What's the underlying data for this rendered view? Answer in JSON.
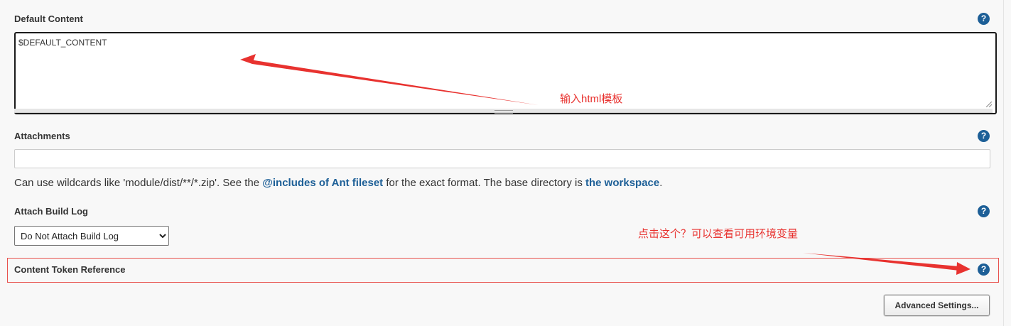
{
  "fields": {
    "default_content": {
      "label": "Default Content",
      "value": "$DEFAULT_CONTENT"
    },
    "attachments": {
      "label": "Attachments",
      "value": "",
      "help_prefix": "Can use wildcards like 'module/dist/**/*.zip'. See the ",
      "help_link_1": "@includes of Ant fileset",
      "help_middle": " for the exact format. The base directory is ",
      "help_link_2": "the workspace",
      "help_suffix": "."
    },
    "attach_build_log": {
      "label": "Attach Build Log",
      "selected": "Do Not Attach Build Log"
    },
    "content_token_reference": {
      "label": "Content Token Reference"
    }
  },
  "buttons": {
    "advanced_settings": "Advanced Settings..."
  },
  "help_icon_glyph": "?",
  "annotations": {
    "template_note": "输入html模板",
    "token_note": "点击这个？可以查看可用环境变量"
  },
  "colors": {
    "link": "#1d5f97",
    "help_icon": "#1d5f97",
    "annotation": "#e8322f",
    "highlight_border": "#e8524e"
  }
}
